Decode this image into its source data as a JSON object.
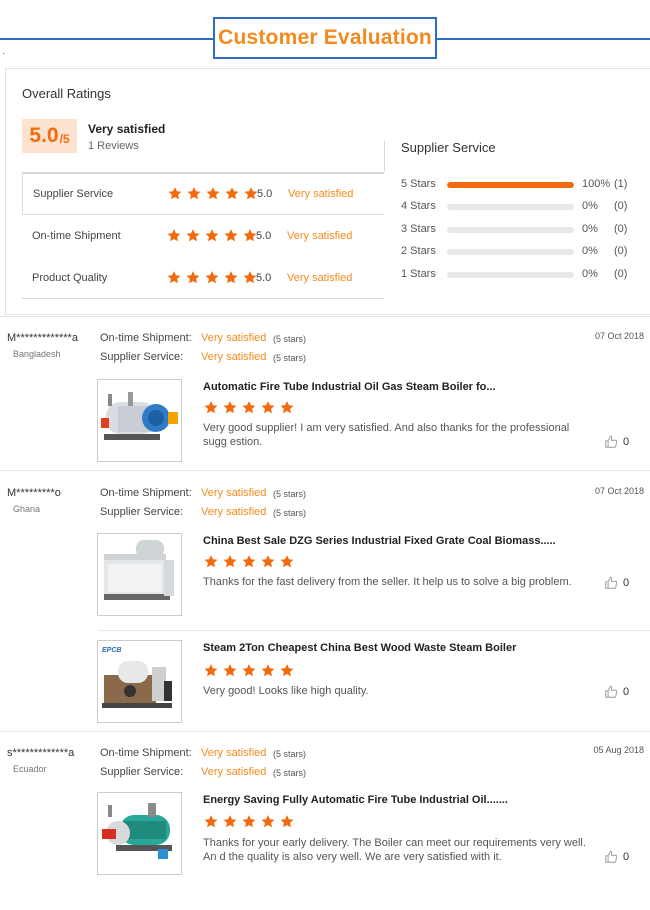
{
  "header": {
    "title": "Customer Evaluation"
  },
  "overall": {
    "title": "Overall Ratings",
    "score": "5.0",
    "score_max": "/5",
    "summary": "Very satisfied",
    "reviews": "1 Reviews",
    "rows": [
      {
        "label": "Supplier Service",
        "value": "5.0",
        "text": "Very satisfied",
        "stars": 5
      },
      {
        "label": "On-time Shipment",
        "value": "5.0",
        "text": "Very satisfied",
        "stars": 5
      },
      {
        "label": "Product Quality",
        "value": "5.0",
        "text": "Very satisfied",
        "stars": 5
      }
    ]
  },
  "supplier_service": {
    "title": "Supplier Service",
    "bars": [
      {
        "label": "5 Stars",
        "fraction": 1.0,
        "pct": "100%",
        "count": "(1)"
      },
      {
        "label": "4 Stars",
        "fraction": 0,
        "pct": "0%",
        "count": "(0)"
      },
      {
        "label": "3 Stars",
        "fraction": 0,
        "pct": "0%",
        "count": "(0)"
      },
      {
        "label": "2 Stars",
        "fraction": 0,
        "pct": "0%",
        "count": "(0)"
      },
      {
        "label": "1 Stars",
        "fraction": 0,
        "pct": "0%",
        "count": "(0)"
      }
    ]
  },
  "reviews": [
    {
      "user": "M*************a",
      "country": "Bangladesh",
      "date": "07 Oct 2018",
      "shipment_key": "On-time Shipment:",
      "shipment_val": "Very satisfied",
      "shipment_stars": "(5 stars)",
      "service_key": "Supplier Service:",
      "service_val": "Very satisfied",
      "service_stars": "(5 stars)",
      "products": [
        {
          "title": "Automatic Fire Tube Industrial Oil Gas Steam Boiler fo...",
          "comment": "Very good supplier! I am very satisfied. And also thanks for the professional sugg estion.",
          "likes": "0",
          "stars": 5
        }
      ]
    },
    {
      "user": "M*********o",
      "country": "Ghana",
      "date": "07 Oct 2018",
      "shipment_key": "On-time Shipment:",
      "shipment_val": "Very satisfied",
      "shipment_stars": "(5 stars)",
      "service_key": "Supplier Service:",
      "service_val": "Very satisfied",
      "service_stars": "(5 stars)",
      "products": [
        {
          "title": "China Best Sale DZG Series Industrial Fixed Grate Coal Biomass.....",
          "comment": "Thanks for the fast delivery from the seller. It help us to solve a big problem.",
          "likes": "0",
          "stars": 5
        },
        {
          "title": "Steam 2Ton Cheapest China Best Wood Waste Steam Boiler",
          "comment": "Very good! Looks like high quality.",
          "likes": "0",
          "stars": 5,
          "logo": "EPCB"
        }
      ]
    },
    {
      "user": "s*************a",
      "country": "Ecuador",
      "date": "05 Aug 2018",
      "shipment_key": "On-time Shipment:",
      "shipment_val": "Very satisfied",
      "shipment_stars": "(5 stars)",
      "service_key": "Supplier Service:",
      "service_val": "Very satisfied",
      "service_stars": "(5 stars)",
      "products": [
        {
          "title": "Energy Saving Fully Automatic Fire Tube Industrial Oil.......",
          "comment": "Thanks for your early delivery. The Boiler can meet our requirements very well. An d the quality is also very well. We are very satisfied with it.",
          "likes": "0",
          "stars": 5
        }
      ]
    }
  ],
  "colors": {
    "accent": "#f36a0e",
    "header_blue": "#2a6ebd",
    "star": "#f36a0e"
  }
}
